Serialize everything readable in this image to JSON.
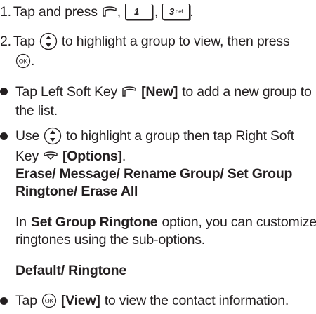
{
  "steps": [
    {
      "number": "1.",
      "text_a": "Tap and press",
      "sep1": ",",
      "key1_num": "1",
      "key1_sub": "..",
      "sep2": ",",
      "key2_num": "3",
      "key2_sub": "def",
      "end": "."
    },
    {
      "number": "2.",
      "text_a": "Tap",
      "text_b": "to highlight a group to view, then press",
      "end": "."
    }
  ],
  "bullets": {
    "new_a": "Tap Left Soft Key",
    "new_key": "[New]",
    "new_b": "to add a new group to",
    "new_c": "the list.",
    "opt_a": "Use",
    "opt_b": "to highlight a group then tap Right Soft",
    "opt_c": "Key",
    "opt_key": "[Options]",
    "opt_end": ".",
    "menu_line1": "Erase/ Message/ Rename Group/ Set Group",
    "menu_line2": "Ringtone/ Erase All",
    "ring_a": "In",
    "ring_bold": "Set Group Ringtone",
    "ring_b": "option, you can customize",
    "ring_c": "ringtones using the sub-options.",
    "sub_options": "Default/ Ringtone",
    "view_a": "Tap",
    "view_key": "[View]",
    "view_b": "to view the contact information."
  },
  "icons": {
    "menu_soft_key": "left-soft-key-icon",
    "nav_key": "navigation-key-icon",
    "ok_key": "ok-key-icon",
    "right_soft_key": "right-soft-key-icon"
  }
}
